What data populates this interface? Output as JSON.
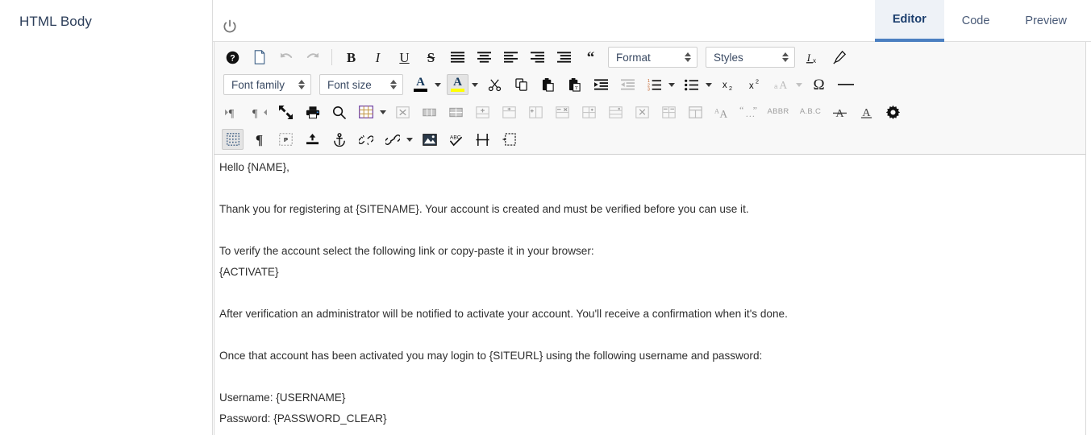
{
  "field": {
    "label": "HTML Body"
  },
  "topbar": {
    "power_icon": "power-toggle-icon",
    "tabs": [
      {
        "label": "Editor",
        "active": true
      },
      {
        "label": "Code",
        "active": false
      },
      {
        "label": "Preview",
        "active": false
      }
    ]
  },
  "toolbar": {
    "rows": [
      {
        "name": "row-document-formatting",
        "items": [
          {
            "name": "help-button",
            "icon": "help-circle-icon",
            "state": "normal"
          },
          {
            "name": "new-page-button",
            "icon": "new-page-icon",
            "state": "normal"
          },
          {
            "name": "undo-button",
            "icon": "undo-arrow-icon",
            "state": "disabled"
          },
          {
            "name": "redo-button",
            "icon": "redo-arrow-icon",
            "state": "disabled"
          },
          {
            "name": "separator",
            "icon": "separator",
            "state": "normal"
          },
          {
            "name": "bold-button",
            "icon": "bold-icon",
            "state": "normal",
            "glyph": "B"
          },
          {
            "name": "italic-button",
            "icon": "italic-icon",
            "state": "normal",
            "glyph": "I"
          },
          {
            "name": "underline-button",
            "icon": "underline-icon",
            "state": "normal",
            "glyph": "U"
          },
          {
            "name": "strikethrough-button",
            "icon": "strikethrough-icon",
            "state": "normal",
            "glyph": "S"
          },
          {
            "name": "align-justify-button",
            "icon": "align-justify-icon",
            "state": "normal"
          },
          {
            "name": "align-center-button",
            "icon": "align-center-icon",
            "state": "normal"
          },
          {
            "name": "align-left-button",
            "icon": "align-left-icon",
            "state": "normal"
          },
          {
            "name": "align-right-button",
            "icon": "align-right-icon",
            "state": "normal"
          },
          {
            "name": "indent-block-button",
            "icon": "indent-block-icon",
            "state": "normal"
          },
          {
            "name": "blockquote-button",
            "icon": "blockquote-icon",
            "state": "normal"
          },
          {
            "name": "format-select",
            "icon": "format-dropdown",
            "state": "normal"
          },
          {
            "name": "styles-select",
            "icon": "styles-dropdown",
            "state": "normal"
          },
          {
            "name": "remove-format-button",
            "icon": "remove-format-icon",
            "state": "normal"
          },
          {
            "name": "copy-formatting-button",
            "icon": "paint-brush-icon",
            "state": "normal"
          }
        ]
      }
    ],
    "format_placeholder": "Format",
    "styles_placeholder": "Styles",
    "fontfamily_placeholder": "Font family",
    "fontsize_placeholder": "Font size",
    "abbr_label": "ABBR",
    "acronym_label": "A.B.C"
  },
  "document": {
    "lines": [
      "Hello {NAME},",
      "",
      "Thank you for registering at {SITENAME}. Your account is created and must be verified before you can use it.",
      "",
      "To verify the account select the following link or copy-paste it in your browser:",
      "{ACTIVATE}",
      "",
      "After verification an administrator will be notified to activate your account. You'll receive a confirmation when it's done.",
      "",
      "Once that account has been activated you may login to {SITEURL} using the following username and password:",
      "",
      "Username: {USERNAME}",
      "Password: {PASSWORD_CLEAR}"
    ]
  },
  "colors": {
    "accent_blue": "#4a7fc1",
    "active_tab_bg": "#eef2f7",
    "toolbar_bg": "#f8f8f8",
    "text": "#2e2e2e",
    "highlight_yellow": "#ffff00",
    "font_color_black": "#000000"
  }
}
